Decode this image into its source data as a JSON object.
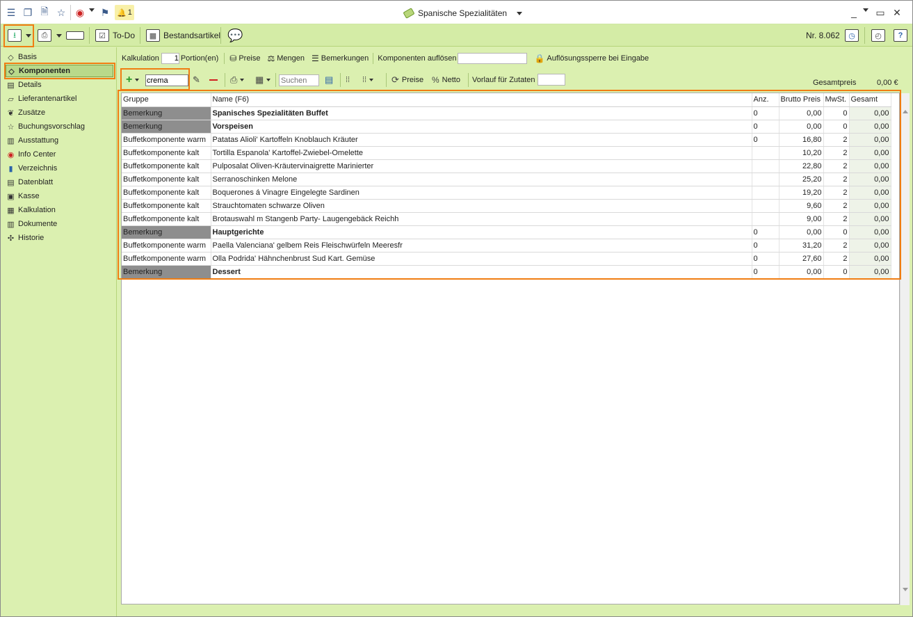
{
  "titlebar": {
    "title": "Spanische Spezialitäten",
    "notification_count": "1"
  },
  "toolbar": {
    "todo_label": "To-Do",
    "bestandsartikel_label": "Bestandsartikel",
    "number_label": "Nr. 8.062"
  },
  "sidebar": {
    "items": [
      {
        "label": "Basis",
        "icon": "tag-icon"
      },
      {
        "label": "Komponenten",
        "icon": "tag-icon"
      },
      {
        "label": "Details",
        "icon": "document-icon"
      },
      {
        "label": "Lieferantenartikel",
        "icon": "truck-icon"
      },
      {
        "label": "Zusätze",
        "icon": "leaf-icon"
      },
      {
        "label": "Buchungsvorschlag",
        "icon": "star-icon"
      },
      {
        "label": "Ausstattung",
        "icon": "barcode-icon"
      },
      {
        "label": "Info Center",
        "icon": "compass-icon"
      },
      {
        "label": "Verzeichnis",
        "icon": "book-icon"
      },
      {
        "label": "Datenblatt",
        "icon": "sheet-icon"
      },
      {
        "label": "Kasse",
        "icon": "register-icon"
      },
      {
        "label": "Kalkulation",
        "icon": "table-icon"
      },
      {
        "label": "Dokumente",
        "icon": "documents-icon"
      },
      {
        "label": "Historie",
        "icon": "history-icon"
      }
    ]
  },
  "calc_bar": {
    "kalkulation_label": "Kalkulation",
    "portions_value": "1",
    "portions_label": "Portion(en)",
    "preise_label": "Preise",
    "mengen_label": "Mengen",
    "bemerkungen_label": "Bemerkungen",
    "komponenten_aufloesen_label": "Komponenten auflösen",
    "aufloesungssperre_label": "Auflösungssperre bei Eingabe"
  },
  "grid_toolbar": {
    "add_input_value": "crema",
    "search_placeholder": "Suchen",
    "preise_label": "Preise",
    "netto_label": "Netto",
    "vorlauf_label": "Vorlauf für Zutaten",
    "gesamtpreis_label": "Gesamtpreis",
    "gesamtpreis_value": "0,00 €"
  },
  "table": {
    "columns": [
      "Gruppe",
      "Name (F6)",
      "Anz.",
      "Brutto Preis",
      "MwSt.",
      "Gesamt"
    ],
    "rows": [
      {
        "gruppe": "Bemerkung",
        "name": "Spanisches Spezialitäten Buffet",
        "anz": "0",
        "brutto": "0,00",
        "mwst": "0",
        "gesamt": "0,00",
        "remark": true
      },
      {
        "gruppe": "Bemerkung",
        "name": "Vorspeisen",
        "anz": "0",
        "brutto": "0,00",
        "mwst": "0",
        "gesamt": "0,00",
        "remark": true
      },
      {
        "gruppe": "Buffetkomponente warm",
        "name": "Patatas Alioli' Kartoffeln Knoblauch Kräuter",
        "anz": "0",
        "brutto": "16,80",
        "mwst": "2",
        "gesamt": "0,00",
        "remark": false
      },
      {
        "gruppe": "Buffetkomponente kalt",
        "name": "Tortilla Espanola' Kartoffel-Zwiebel-Omelette",
        "anz": "",
        "brutto": "10,20",
        "mwst": "2",
        "gesamt": "0,00",
        "remark": false
      },
      {
        "gruppe": "Buffetkomponente kalt",
        "name": "Pulposalat Oliven-Kräutervinaigrette Marinierter",
        "anz": "",
        "brutto": "22,80",
        "mwst": "2",
        "gesamt": "0,00",
        "remark": false
      },
      {
        "gruppe": "Buffetkomponente kalt",
        "name": "Serranoschinken Melone",
        "anz": "",
        "brutto": "25,20",
        "mwst": "2",
        "gesamt": "0,00",
        "remark": false
      },
      {
        "gruppe": "Buffetkomponente kalt",
        "name": "Boquerones á Vinagre Eingelegte Sardinen",
        "anz": "",
        "brutto": "19,20",
        "mwst": "2",
        "gesamt": "0,00",
        "remark": false
      },
      {
        "gruppe": "Buffetkomponente kalt",
        "name": "Strauchtomaten schwarze Oliven",
        "anz": "",
        "brutto": "9,60",
        "mwst": "2",
        "gesamt": "0,00",
        "remark": false
      },
      {
        "gruppe": "Buffetkomponente kalt",
        "name": "Brotauswahl m Stangenb Party- Laugengebäck Reichh",
        "anz": "",
        "brutto": "9,00",
        "mwst": "2",
        "gesamt": "0,00",
        "remark": false
      },
      {
        "gruppe": "Bemerkung",
        "name": "Hauptgerichte",
        "anz": "0",
        "brutto": "0,00",
        "mwst": "0",
        "gesamt": "0,00",
        "remark": true
      },
      {
        "gruppe": "Buffetkomponente warm",
        "name": "Paella Valenciana' gelbem Reis Fleischwürfeln Meeresfr",
        "anz": "0",
        "brutto": "31,20",
        "mwst": "2",
        "gesamt": "0,00",
        "remark": false
      },
      {
        "gruppe": "Buffetkomponente warm",
        "name": "Olla Podrida' Hähnchenbrust Sud Kart. Gemüse",
        "anz": "0",
        "brutto": "27,60",
        "mwst": "2",
        "gesamt": "0,00",
        "remark": false
      },
      {
        "gruppe": "Bemerkung",
        "name": "Dessert",
        "anz": "0",
        "brutto": "0,00",
        "mwst": "0",
        "gesamt": "0,00",
        "remark": true
      }
    ]
  },
  "colors": {
    "background": "#dbf0b0",
    "toolbar": "#d4eca6",
    "highlight_border": "#f07d12",
    "remark_cell": "#8e8e8e"
  }
}
